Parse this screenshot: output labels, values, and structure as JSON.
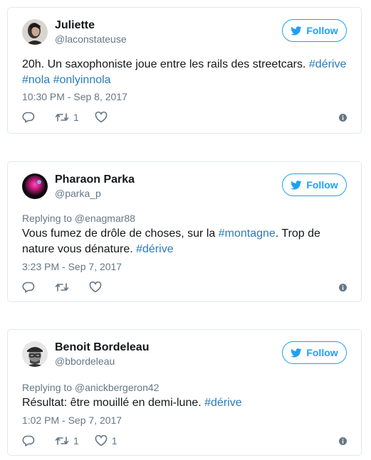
{
  "colors": {
    "accent": "#1da1f2",
    "link": "#2b7bb9",
    "muted": "#657786",
    "border": "#e1e8ed",
    "text": "#14171a"
  },
  "follow_label": "Follow",
  "tweets": [
    {
      "display_name": "Juliette",
      "screen_name": "@laconstateuse",
      "avatar": "avatar-woman-dark-hair",
      "reply_to": "",
      "text_plain_1": "20h. Un saxophoniste joue entre les rails des streetcars. ",
      "tag_1": "#dérive",
      "text_plain_2": "",
      "tag_2": "#nola",
      "text_plain_3": " ",
      "tag_3": "#onlyinnola",
      "timestamp": "10:30 PM - Sep 8, 2017",
      "reply_count": "",
      "retweet_count": "1",
      "like_count": ""
    },
    {
      "display_name": "Pharaon Parka",
      "screen_name": "@parka_p",
      "avatar": "avatar-magenta-abstract",
      "reply_to": "Replying to @enagmar88",
      "text_plain_1": "Vous fumez de drôle de choses, sur la ",
      "tag_1": "#montagne",
      "text_plain_2": ". Trop de nature vous dénature. ",
      "tag_2": "#dérive",
      "timestamp": "3:23 PM - Sep 7, 2017",
      "reply_count": "",
      "retweet_count": "",
      "like_count": ""
    },
    {
      "display_name": "Benoit Bordeleau",
      "screen_name": "@bbordeleau",
      "avatar": "avatar-man-cap-glasses",
      "reply_to": "Replying to @anickbergeron42",
      "text_plain_1": "Résultat: être mouillé en demi-lune. ",
      "tag_1": "#dérive",
      "timestamp": "1:02 PM - Sep 7, 2017",
      "reply_count": "",
      "retweet_count": "1",
      "like_count": "1"
    }
  ]
}
